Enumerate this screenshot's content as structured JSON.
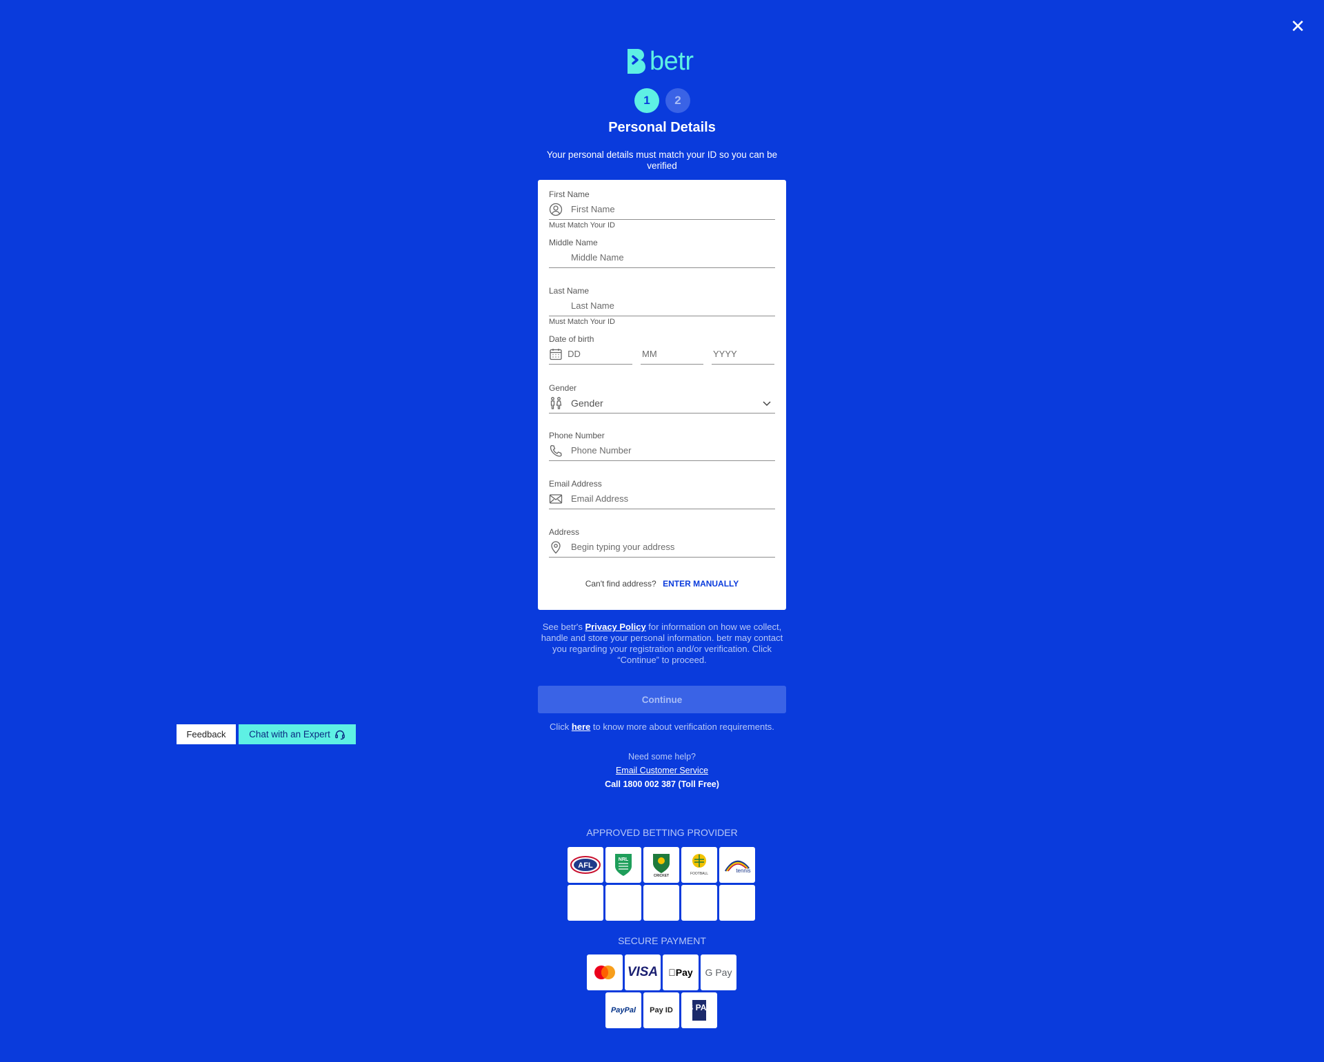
{
  "header": {
    "close_icon": "✕",
    "logo_text": "betr",
    "brand_accent": "#5ef0e4",
    "background": "#0a3bdc"
  },
  "steps": [
    {
      "label": "1",
      "active": true
    },
    {
      "label": "2",
      "active": false
    }
  ],
  "page": {
    "title": "Personal Details",
    "subtitle": "Your personal details must match your ID so you can be verified"
  },
  "form": {
    "first_name": {
      "label": "First Name",
      "placeholder": "First Name",
      "hint": "Must Match Your ID",
      "icon": "user-icon"
    },
    "middle_name": {
      "label": "Middle Name",
      "placeholder": "Middle Name"
    },
    "last_name": {
      "label": "Last Name",
      "placeholder": "Last Name",
      "hint": "Must Match Your ID"
    },
    "dob": {
      "label": "Date of birth",
      "dd_placeholder": "DD",
      "mm_placeholder": "MM",
      "yyyy_placeholder": "YYYY",
      "icon": "calendar-icon"
    },
    "gender": {
      "label": "Gender",
      "value": "Gender",
      "icon": "gender-icon"
    },
    "phone": {
      "label": "Phone Number",
      "placeholder": "Phone Number",
      "icon": "phone-icon"
    },
    "email": {
      "label": "Email Address",
      "placeholder": "Email Address",
      "icon": "mail-icon"
    },
    "address": {
      "label": "Address",
      "placeholder": "Begin typing your address",
      "icon": "location-pin-icon"
    },
    "cant_find": "Can't find address?",
    "enter_manually": "ENTER MANUALLY"
  },
  "privacy": {
    "prefix": "See betr's ",
    "link": "Privacy Policy",
    "suffix": " for information on how we collect, handle and store your personal information. betr may contact you regarding your registration and/or verification. Click “Continue” to proceed."
  },
  "continue_label": "Continue",
  "verification": {
    "prefix": "Click ",
    "link": "here",
    "suffix": " to know more about verification requirements."
  },
  "help": {
    "need_help": "Need some help?",
    "email": "Email Customer Service",
    "call": "Call 1800 002 387 (Toll Free)"
  },
  "floating": {
    "feedback": "Feedback",
    "chat": "Chat with an Expert",
    "chat_icon": "headset-icon"
  },
  "approved": {
    "title": "APPROVED BETTING PROVIDER",
    "logos": [
      "AFL",
      "NRL",
      "CRICKET",
      "FOOTBALL",
      "tennis",
      "",
      "",
      "",
      "",
      ""
    ]
  },
  "secure": {
    "title": "SECURE PAYMENT",
    "row1": [
      "mastercard",
      "VISA",
      "Pay",
      "G Pay"
    ],
    "row2": [
      "PayPal",
      "Pay ID",
      "B PAY"
    ]
  }
}
